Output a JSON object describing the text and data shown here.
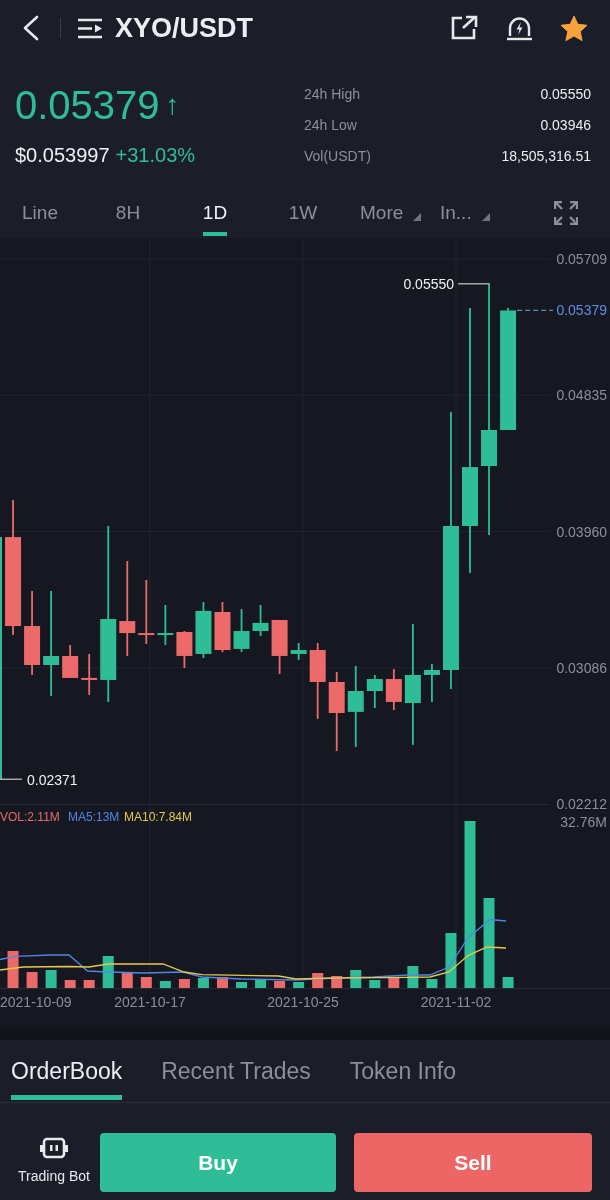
{
  "header": {
    "title": "XYO/USDT",
    "favorited": true
  },
  "price": {
    "last": "0.05379",
    "rising": true,
    "trend_arrow": "↑",
    "fiat_value": "$0.053997",
    "change": "+31.03%"
  },
  "stats": [
    {
      "label": "24h High",
      "value": "0.05550"
    },
    {
      "label": "24h Low",
      "value": "0.03946"
    },
    {
      "label": "Vol(USDT)",
      "value": "18,505,316.51"
    }
  ],
  "chart_tabs": [
    {
      "label": "Line",
      "kind": "interval",
      "selected": false
    },
    {
      "label": "8H",
      "kind": "interval",
      "selected": false
    },
    {
      "label": "1D",
      "kind": "interval",
      "selected": true
    },
    {
      "label": "1W",
      "kind": "interval",
      "selected": false
    },
    {
      "label": "More",
      "kind": "dropdown",
      "selected": false
    },
    {
      "label": "In...",
      "kind": "dropdown",
      "selected": false
    }
  ],
  "price_chart": {
    "chart_data": {
      "type": "candlestick",
      "categories": [
        null,
        null,
        null,
        null,
        null,
        null,
        null,
        null,
        null,
        null,
        null,
        null,
        null,
        null,
        null,
        null,
        null,
        null,
        null,
        null,
        null,
        null,
        null,
        null,
        null,
        null,
        null,
        null
      ],
      "ohlc": [
        [
          0.02371,
          0.03925,
          0.02371,
          0.03925
        ],
        [
          0.03925,
          0.04163,
          0.03297,
          0.03354
        ],
        [
          0.03354,
          0.03579,
          0.0304,
          0.03104
        ],
        [
          0.03104,
          0.03579,
          0.02905,
          0.03162
        ],
        [
          0.03162,
          0.03232,
          0.03021,
          0.03021
        ],
        [
          0.03021,
          0.03175,
          0.02912,
          0.03008
        ],
        [
          0.03008,
          0.03996,
          0.02867,
          0.03399
        ],
        [
          0.03386,
          0.03771,
          0.03162,
          0.03309
        ],
        [
          0.03309,
          0.0365,
          0.03239,
          0.03297
        ],
        [
          0.03297,
          0.03489,
          0.03232,
          0.03309
        ],
        [
          0.03316,
          0.03322,
          0.03085,
          0.03162
        ],
        [
          0.03175,
          0.03508,
          0.03149,
          0.03451
        ],
        [
          0.03444,
          0.03508,
          0.03187,
          0.032
        ],
        [
          0.03207,
          0.03463,
          0.03187,
          0.03322
        ],
        [
          0.03322,
          0.03489,
          0.0329,
          0.03374
        ],
        [
          0.03393,
          0.03393,
          0.03046,
          0.03162
        ],
        [
          0.03175,
          0.03245,
          0.03136,
          0.032
        ],
        [
          0.032,
          0.03245,
          0.02758,
          0.02995
        ],
        [
          0.02995,
          0.03059,
          0.02552,
          0.02796
        ],
        [
          0.02803,
          0.03098,
          0.02578,
          0.02937
        ],
        [
          0.02937,
          0.0304,
          0.02828,
          0.03014
        ],
        [
          0.03014,
          0.03078,
          0.02815,
          0.02867
        ],
        [
          0.0286,
          0.03367,
          0.02591,
          0.0304
        ],
        [
          0.0304,
          0.0311,
          0.02867,
          0.03072
        ],
        [
          0.03072,
          0.04727,
          0.0295,
          0.03996
        ],
        [
          0.03996,
          0.05395,
          0.03694,
          0.04374
        ],
        [
          0.04381,
          0.0555,
          0.03938,
          0.04612
        ],
        [
          0.04612,
          0.05395,
          0.04612,
          0.05379
        ]
      ],
      "ylim": [
        0.02212,
        0.05844
      ],
      "yticks": [
        {
          "value": 0.05709,
          "label": "0.05709"
        },
        {
          "value": 0.04835,
          "label": "0.04835"
        },
        {
          "value": 0.0396,
          "label": "0.03960"
        },
        {
          "value": 0.03086,
          "label": "0.03086"
        },
        {
          "value": 0.02212,
          "label": "0.02212"
        }
      ],
      "grid": true
    },
    "high_marker": "0.05550",
    "low_marker": "0.02371",
    "last_price_marker": "0.05379"
  },
  "volume_chart": {
    "legend": [
      {
        "text": "VOL:2.11M",
        "color": "#e86a6a"
      },
      {
        "text": "MA5:13M",
        "color": "#4f86e6"
      },
      {
        "text": "MA10:7.84M",
        "color": "#e6c84a"
      }
    ],
    "axis_label": "32.76M",
    "dates": [
      "2021-10-09",
      "2021-10-17",
      "2021-10-25",
      "2021-11-02"
    ]
  },
  "panel_tabs": [
    {
      "label": "OrderBook",
      "selected": true
    },
    {
      "label": "Recent Trades",
      "selected": false
    },
    {
      "label": "Token Info",
      "selected": false
    }
  ],
  "bottom_bar": {
    "bot_label": "Trading Bot",
    "actions": [
      {
        "label": "Buy",
        "kind": "buy"
      },
      {
        "label": "Sell",
        "kind": "sell"
      }
    ]
  }
}
